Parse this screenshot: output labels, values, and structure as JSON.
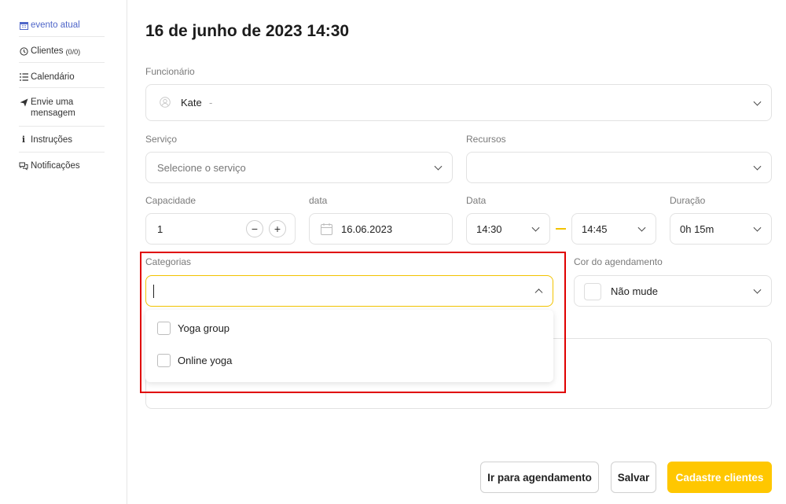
{
  "sidebar": {
    "items": [
      {
        "label": "evento atual",
        "icon": "calendar-icon"
      },
      {
        "label": "Clientes",
        "count": "(0/0)",
        "icon": "clock-icon"
      },
      {
        "label": "Calendário",
        "icon": "list-icon"
      },
      {
        "label": "Envie uma mensagem",
        "icon": "send-icon"
      },
      {
        "label": "Instruções",
        "icon": "info-icon"
      },
      {
        "label": "Notificações",
        "icon": "chat-icon"
      }
    ]
  },
  "header": {
    "title": "16 de junho de 2023 14:30"
  },
  "form": {
    "employee": {
      "label": "Funcionário",
      "value": "Kate",
      "suffix": "-"
    },
    "service": {
      "label": "Serviço",
      "placeholder": "Selecione o serviço"
    },
    "resources": {
      "label": "Recursos",
      "value": ""
    },
    "capacity": {
      "label": "Capacidade",
      "value": "1",
      "minus": "−",
      "plus": "+"
    },
    "date": {
      "label": "data",
      "value": "16.06.2023"
    },
    "time": {
      "label": "Data",
      "start": "14:30",
      "end": "14:45"
    },
    "duration": {
      "label": "Duração",
      "value": "0h 15m"
    },
    "categories": {
      "label": "Categorias",
      "value": "",
      "options": [
        "Yoga group",
        "Online yoga"
      ]
    },
    "color": {
      "label": "Cor do agendamento",
      "value": "Não mude"
    }
  },
  "actions": {
    "go_to": "Ir para agendamento",
    "save": "Salvar",
    "register": "Cadastre clientes"
  },
  "colors": {
    "accent": "#ffc700",
    "sidebar_active": "#4f66c9",
    "highlight": "#e00000"
  }
}
